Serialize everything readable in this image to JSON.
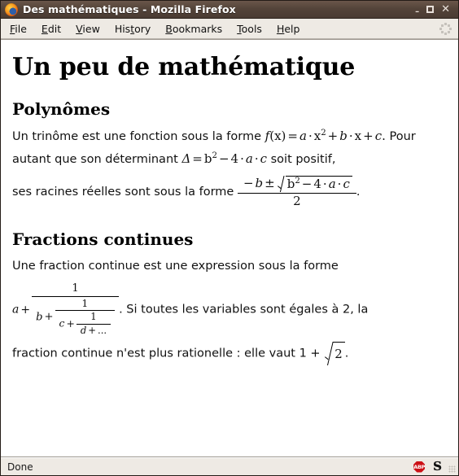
{
  "window": {
    "title": "Des mathématiques - Mozilla Firefox",
    "logo_icon": "firefox-logo",
    "minimize_label": "–",
    "maximize_label": "",
    "close_label": "✕"
  },
  "menubar": {
    "items": [
      {
        "label": "File",
        "accel_index": 0
      },
      {
        "label": "Edit",
        "accel_index": 0
      },
      {
        "label": "View",
        "accel_index": 0
      },
      {
        "label": "History",
        "accel_index": 3
      },
      {
        "label": "Bookmarks",
        "accel_index": 0
      },
      {
        "label": "Tools",
        "accel_index": 0
      },
      {
        "label": "Help",
        "accel_index": 0
      }
    ],
    "throbber_icon": "throbber-icon"
  },
  "page": {
    "title": "Un peu de mathématique",
    "sections": [
      {
        "heading": "Polynômes",
        "text_1": "Un trinôme est une fonction sous la forme",
        "formula_1": "f(x) = a·x2 + b·x + c.",
        "text_2": "Pour autant que son déterminant",
        "formula_2": "Δ = b2 − 4·a·c",
        "text_3": "soit positif,",
        "text_4": "ses racines réelles sont sous la forme",
        "formula_3": "(−b ± √(b2 − 4·a·c)) / 2",
        "formula_3_parts": {
          "minus_b": "−",
          "b": "b",
          "plus_minus": "±",
          "radicand_b": "b",
          "radicand_exp": "2",
          "radicand_minus": "−",
          "radicand_four": "4",
          "dot": "·",
          "radicand_a": "a",
          "radicand_c": "c",
          "denominator": "2"
        },
        "period": "."
      },
      {
        "heading": "Fractions continues",
        "text_1": "Une fraction continue est une expression sous la forme",
        "formula_1": "a + 1/(b + 1/(c + 1/(d + ...)))",
        "formula_1_parts": {
          "a": "a",
          "plus": "+",
          "one": "1",
          "b": "b",
          "c": "c",
          "d": "d",
          "ellipsis": "..."
        },
        "text_2": ". Si toutes les variables sont égales à 2, la",
        "text_3": "fraction continue n'est plus rationelle : elle vaut 1 +",
        "formula_2": "√2",
        "formula_2_parts": {
          "one": "1",
          "plus": "+",
          "radicand": "2"
        },
        "period": "."
      }
    ]
  },
  "statusbar": {
    "status": "Done",
    "adblock_icon": "adblock-plus-icon",
    "adblock_label": "ABP",
    "noscript_icon": "noscript-icon",
    "noscript_label": "S",
    "resize_grip_icon": "resize-grip-icon"
  }
}
